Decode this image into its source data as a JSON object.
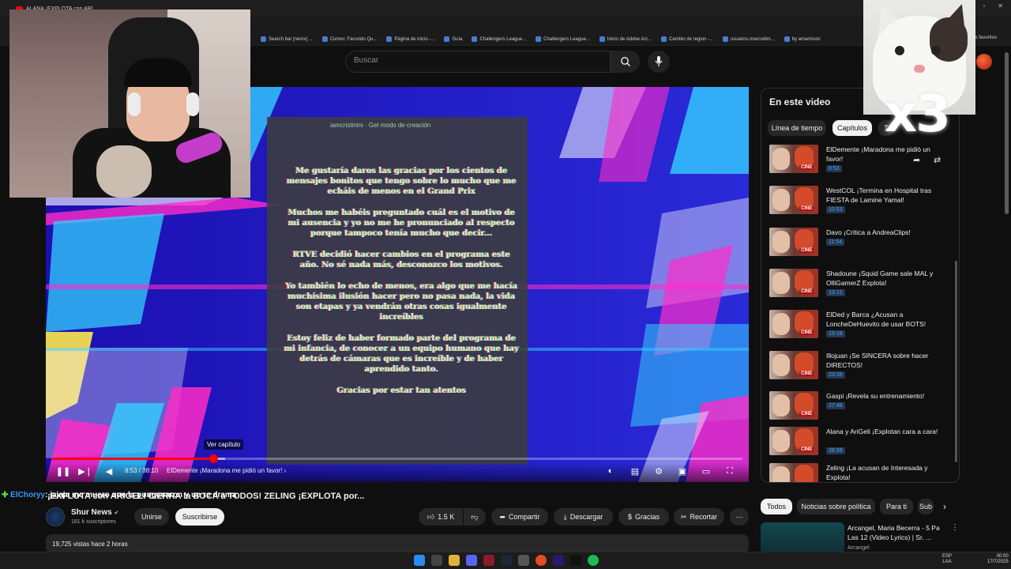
{
  "browser": {
    "tab_title": "ALANA ¡EXPLOTA con ARI...",
    "bookmarks": [
      "Search bar [nemx] ...",
      "Correo: Facundo Qu...",
      "Página de inicio -...",
      "Guía",
      "Challengers League...",
      "Challengers League...",
      "Inicio de Adobe Acr...",
      "Cambio de region -...",
      "usuarios.marcodim...",
      "by amarmunc"
    ],
    "favorites_label": "...los favoritos"
  },
  "header": {
    "search_placeholder": "Buscar"
  },
  "player": {
    "chat_user": "iamcristinini",
    "chat_sub": "Gel modo de creación",
    "message_lines": [
      "Me gustaría daros las gracias por los cientos de mensajes bonitos que tengo sobre lo mucho que me echáis de menos en el Grand Prix",
      "Muchos me habéis preguntado cuál es el motivo de mi ausencia y yo no me he pronunciado al respecto porque tampoco tenía mucho que decir...",
      "RTVE decidió hacer cambios en el programa este año. No sé nada más, desconozco los motivos.",
      "Yo también lo echo de menos, era algo que me hacía muchísima ilusión hacer pero no pasa nada, la vida son etapas y ya vendrán otras cosas igualmente increíbles",
      "Estoy feliz de haber formado parte del programa de mi infancia, de conocer a un equipo humano que hay detrás de cámaras que es increíble y de haber aprendido tanto.",
      "Gracias por estar tan atentos"
    ],
    "tooltip": "Ver capítulo",
    "progress": 0.233,
    "time": "8:53 / 38:10",
    "chapter": "ElDemente ¡Maradona me pidió un favor!",
    "chapter_arrow": "›"
  },
  "video": {
    "chat_plus": "✚",
    "chat_user": "ElChoryy",
    "chat_message": ": jajaja me muero que la punguearon y un re drama",
    "title": "¡EXPLOTA con ARIGELI CIERRA la BOCA a TODOS! ZELING ¡EXPLOTA por...",
    "channel": "Shur News",
    "verified": "✔",
    "subscribers": "181 k suscriptores",
    "join": "Unirse",
    "subscribe": "Suscribirse",
    "likes": "1.5 K",
    "share": "Compartir",
    "download": "Descargar",
    "thanks": "Gracias",
    "clip": "Recortar",
    "more": "⋯",
    "stats": "19,725 vistas  hace 2 horas"
  },
  "chapters_panel": {
    "title": "En este video",
    "tabs": [
      "Línea de tiempo",
      "Capítulos",
      "T"
    ],
    "items": [
      {
        "title": "ElDemente ¡Maradona me pidió un favor!",
        "time": "8:53",
        "active": true
      },
      {
        "title": "WestCOL ¡Termina en Hospital tras FIESTA de Lamine Yamal!",
        "time": "10:53"
      },
      {
        "title": "Davo ¡Critica a AndreaClips!",
        "time": "11:54"
      },
      {
        "title": "Shadoune ¡Squid Game sale MAL y OlliGamerZ Explota!",
        "time": "13:12"
      },
      {
        "title": "ElDed y Barca ¿Acusan a LoncheDeHuevito de usar BOTS!",
        "time": "19:18"
      },
      {
        "title": "Illojuan ¡Se SINCERA sobre hacer DIRECTOS!",
        "time": "23:26"
      },
      {
        "title": "Gaspi ¡Revela su entrenamiento!",
        "time": "27:48"
      },
      {
        "title": "Alana y AriGeli ¡Explotan cara a cara!",
        "time": "28:59"
      },
      {
        "title": "Zeling ¡La acusan de Interesada y Explota!",
        "time": ""
      }
    ],
    "thumb_badge": "CINE"
  },
  "overlay": {
    "cat_text": "x3"
  },
  "recommendations": {
    "chips": [
      "Todos",
      "Noticias sobre política",
      "Para ti",
      "Sub"
    ],
    "item_title": "Arcangel, Maria Becerra - 5 Pa Las 12 (Video Lyrics) | Sr. ...",
    "item_channel": "Arcangel"
  },
  "taskbar": {
    "lang": "ESP\nLAA",
    "time": "00:00",
    "date": "17/7/2025"
  }
}
